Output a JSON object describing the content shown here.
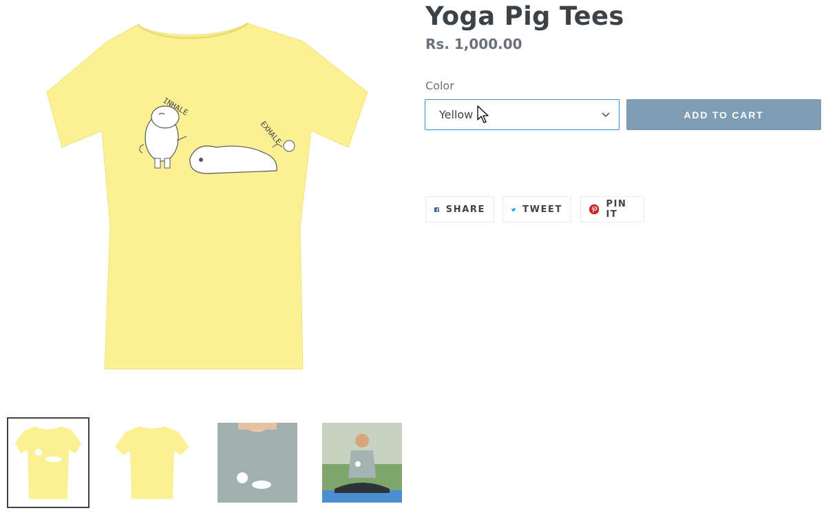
{
  "product": {
    "title": "Yoga Pig Tees",
    "price": "Rs. 1,000.00",
    "main_image": {
      "shirt_color": "#fbf094",
      "print_text_left": "INHALE",
      "print_text_right": "EXHALE"
    }
  },
  "options": {
    "color_label": "Color",
    "color_selected": "Yellow"
  },
  "actions": {
    "add_to_cart": "ADD TO CART",
    "add_to_cart_color": "#7f9cb5"
  },
  "share": {
    "facebook": "SHARE",
    "twitter": "TWEET",
    "pinterest": "PIN IT",
    "facebook_color": "#3b5998",
    "twitter_color": "#1da1f2",
    "pinterest_color": "#cb2027"
  },
  "thumbnails": [
    {
      "name": "thumbnail-front",
      "description_icon": "yellow-tshirt-front"
    },
    {
      "name": "thumbnail-back",
      "description_icon": "yellow-tshirt-back"
    },
    {
      "name": "thumbnail-model-closeup",
      "description_icon": "gray-tshirt-model"
    },
    {
      "name": "thumbnail-model-yoga",
      "description_icon": "model-meditating"
    }
  ]
}
